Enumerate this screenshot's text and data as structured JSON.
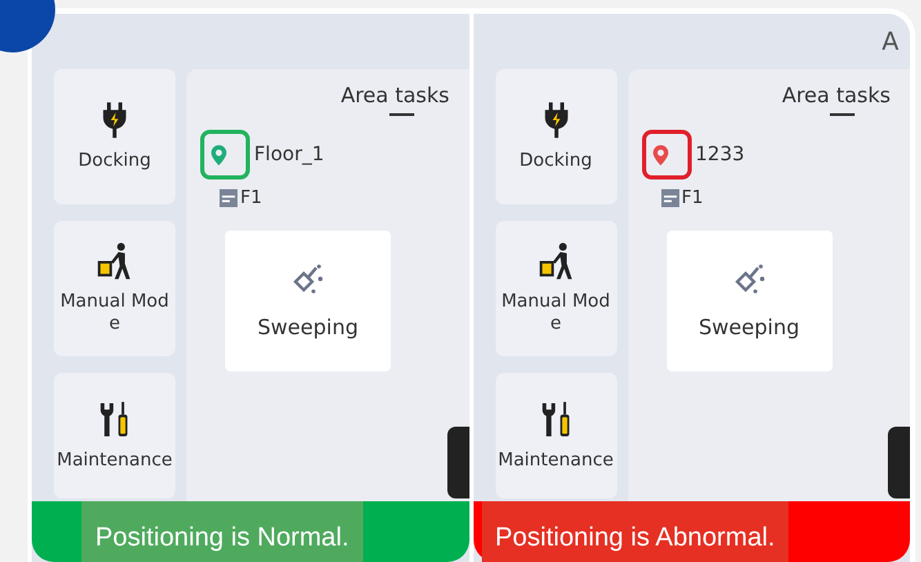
{
  "panels": [
    {
      "kind": "normal",
      "menu": [
        "Docking",
        "Manual Mode",
        "Maintenance"
      ],
      "heading": "Area tasks",
      "location": "Floor_1",
      "floor": "F1",
      "task": "Sweeping",
      "banner": "Positioning is Normal."
    },
    {
      "kind": "abnormal",
      "corner_text": "A",
      "menu": [
        "Docking",
        "Manual Mode",
        "Maintenance"
      ],
      "heading": "Area tasks",
      "location": "1233",
      "floor": "F1",
      "task": "Sweeping",
      "banner": "Positioning is Abnormal."
    }
  ]
}
